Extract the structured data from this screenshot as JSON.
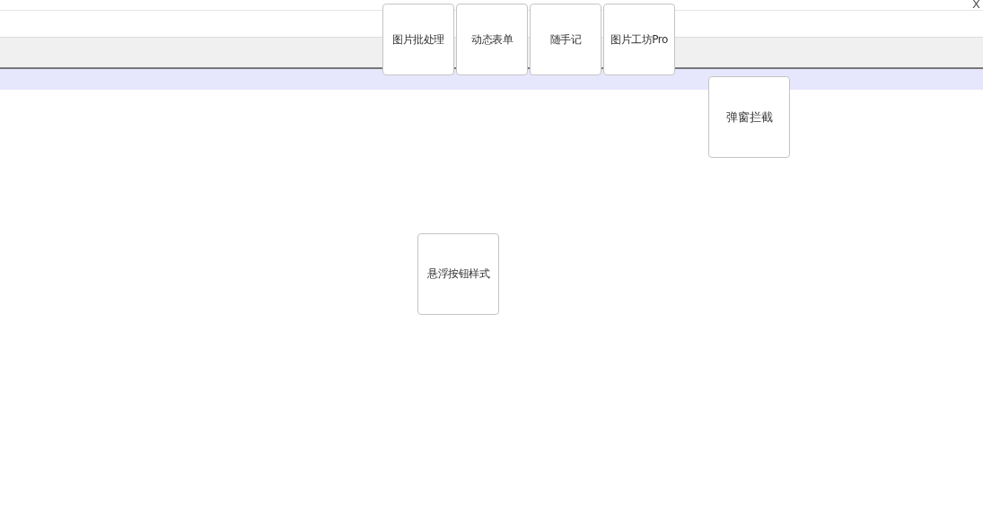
{
  "close_mark": "X",
  "toolbar_buttons": [
    {
      "label": "图片批处理"
    },
    {
      "label": "动态表单"
    },
    {
      "label": "随手记"
    },
    {
      "label": "图片工坊Pro"
    }
  ],
  "popup_block_button": {
    "label": "弹窗拦截"
  },
  "hover_style_button": {
    "label": "悬浮按钮样式"
  }
}
